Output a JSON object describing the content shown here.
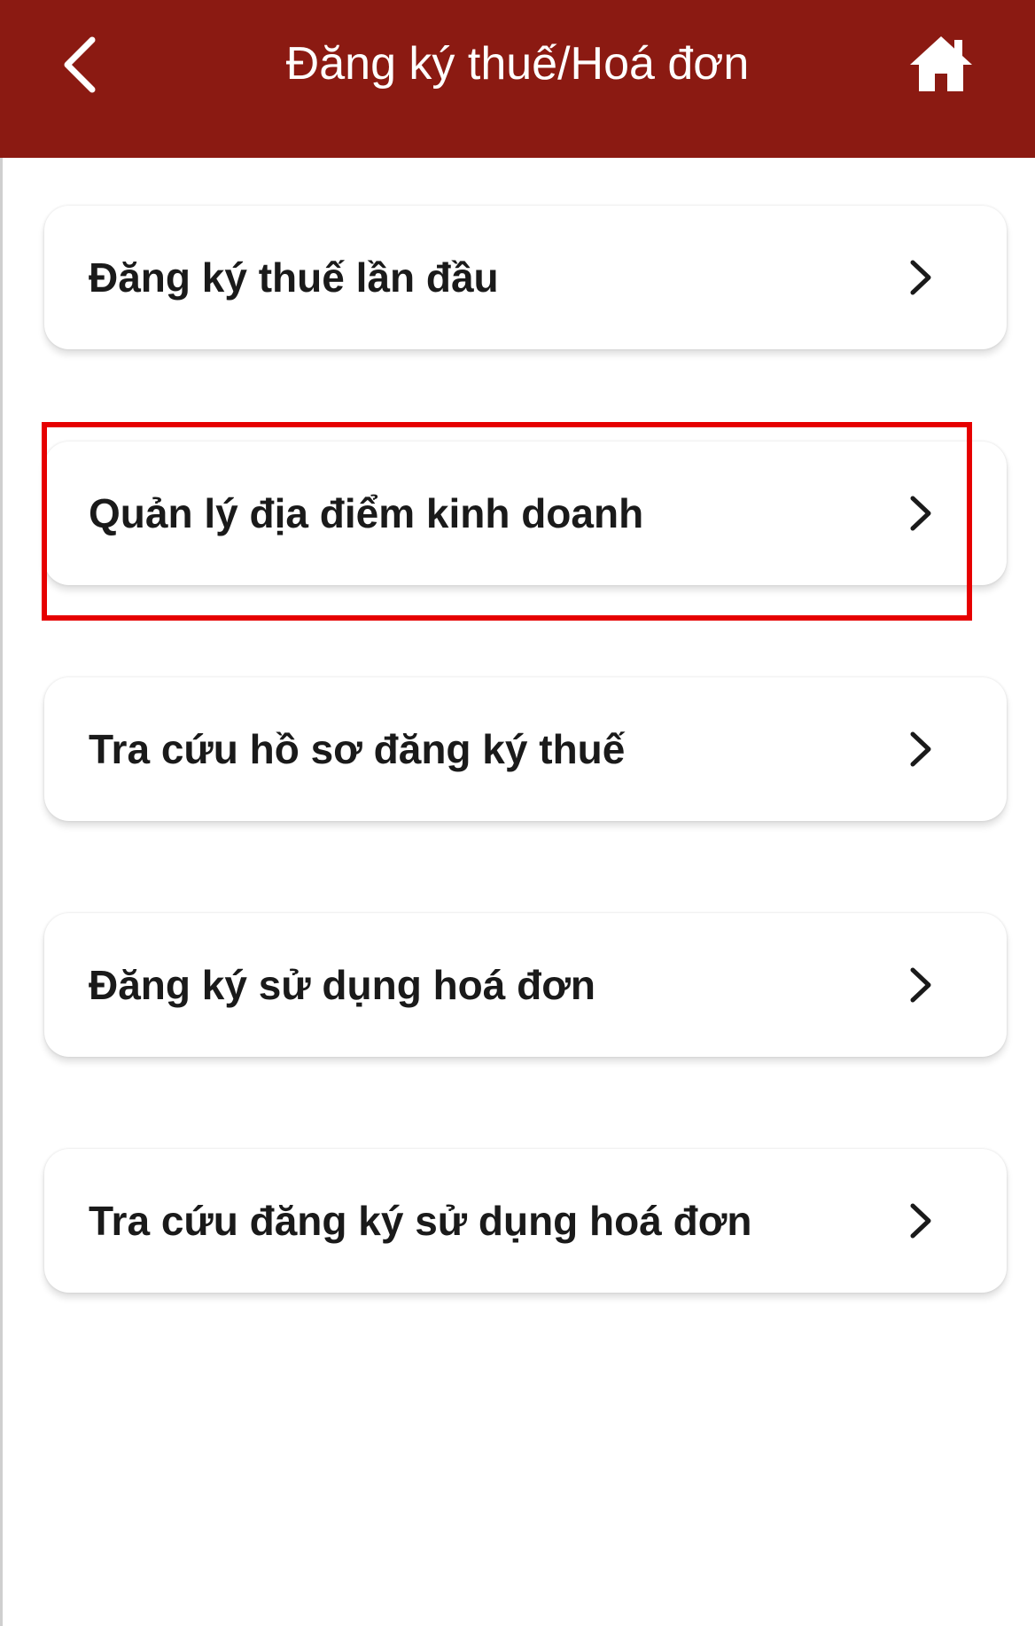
{
  "header": {
    "title": "Đăng ký thuế/Hoá đơn",
    "background_color": "#8b1a12",
    "back_icon": "chevron-left-icon",
    "home_icon": "home-icon"
  },
  "menu": {
    "items": [
      {
        "label": "Đăng ký thuế lần đầu",
        "icon": "chevron-right-icon"
      },
      {
        "label": "Quản lý địa điểm kinh doanh",
        "icon": "chevron-right-icon",
        "highlighted": true
      },
      {
        "label": "Tra cứu hồ sơ đăng ký thuế",
        "icon": "chevron-right-icon"
      },
      {
        "label": "Đăng ký sử dụng hoá đơn",
        "icon": "chevron-right-icon"
      },
      {
        "label": "Tra cứu đăng ký sử dụng hoá đơn",
        "icon": "chevron-right-icon"
      }
    ]
  },
  "highlight_color": "#e60000"
}
